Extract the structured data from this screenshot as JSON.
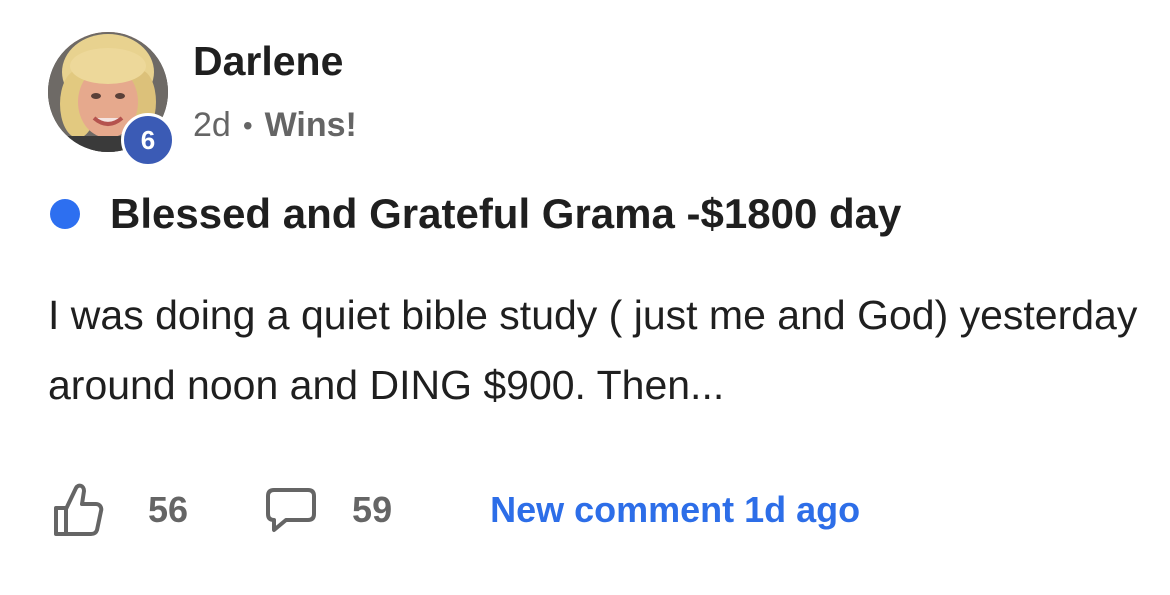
{
  "author": {
    "name": "Darlene",
    "level": "6",
    "avatar_icon": "profile-photo"
  },
  "meta": {
    "time": "2d",
    "separator": "•",
    "category": "Wins!"
  },
  "post": {
    "unread_indicator_color": "#2d6ff0",
    "title": "Blessed and Grateful Grama -$1800 day",
    "body": "I was doing a quiet bible study ( just me and God) yesterday around noon and DING $900. Then..."
  },
  "footer": {
    "like_icon": "thumbs-up-icon",
    "like_count": "56",
    "comment_icon": "comment-bubble-icon",
    "comment_count": "59",
    "new_comment_label": "New comment 1d ago"
  },
  "colors": {
    "accent_blue": "#2d6ee8",
    "badge_blue": "#3b5bb5",
    "muted_text": "#656565",
    "primary_text": "#1f1f1f"
  }
}
